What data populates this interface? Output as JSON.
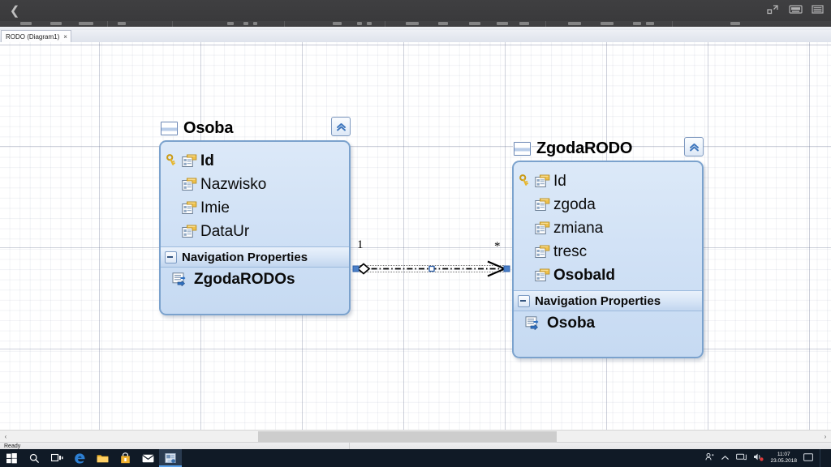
{
  "window": {
    "back_icon": "back-arrow-icon",
    "chrome_buttons": [
      {
        "name": "restore-icon",
        "label": "Restore"
      },
      {
        "name": "keyboard-icon",
        "label": "Touch Keyboard"
      },
      {
        "name": "menu-icon",
        "label": "Menu"
      }
    ]
  },
  "tab": {
    "label": "RODO (Diagram1)",
    "close": "×"
  },
  "diagram": {
    "entities": [
      {
        "name": "Osoba",
        "title": "Osoba",
        "collapse_glyph": "«",
        "properties": [
          {
            "label": "Id",
            "key": true,
            "bold": true
          },
          {
            "label": "Nazwisko",
            "key": false,
            "bold": false
          },
          {
            "label": "Imie",
            "key": false,
            "bold": false
          },
          {
            "label": "DataUr",
            "key": false,
            "bold": false
          }
        ],
        "navigation_header": "Navigation Properties",
        "navigation_properties": [
          {
            "label": "ZgodaRODOs"
          }
        ]
      },
      {
        "name": "ZgodaRODO",
        "title": "ZgodaRODO",
        "collapse_glyph": "«",
        "properties": [
          {
            "label": "Id",
            "key": true,
            "bold": false
          },
          {
            "label": "zgoda",
            "key": false,
            "bold": false
          },
          {
            "label": "zmiana",
            "key": false,
            "bold": false
          },
          {
            "label": "tresc",
            "key": false,
            "bold": false
          },
          {
            "label": "OsobaId",
            "key": false,
            "bold": true
          }
        ],
        "navigation_header": "Navigation Properties",
        "navigation_properties": [
          {
            "label": "Osoba"
          }
        ]
      }
    ],
    "association": {
      "source_multiplicity": "1",
      "target_multiplicity": "*",
      "selected": true
    }
  },
  "status": {
    "text": "Ready"
  },
  "scrollbar": {
    "left_arrow": "‹",
    "right_arrow": "›"
  },
  "taskbar": {
    "items": [
      {
        "name": "start-button",
        "label": "Start"
      },
      {
        "name": "search-icon",
        "label": "Search"
      },
      {
        "name": "task-view-icon",
        "label": "Task View"
      },
      {
        "name": "edge-icon",
        "label": "Microsoft Edge"
      },
      {
        "name": "file-explorer-icon",
        "label": "File Explorer"
      },
      {
        "name": "store-icon",
        "label": "Microsoft Store"
      },
      {
        "name": "mail-icon",
        "label": "Mail"
      },
      {
        "name": "visual-studio-icon",
        "label": "Visual Studio"
      }
    ],
    "tray": [
      {
        "name": "user-account-icon",
        "label": "Account"
      },
      {
        "name": "show-hidden-icons-icon",
        "label": "Show hidden icons"
      },
      {
        "name": "network-icon",
        "label": "Network"
      },
      {
        "name": "volume-icon",
        "label": "Volume"
      }
    ],
    "clock": {
      "time": "11:07",
      "date": "23.05.2018"
    }
  },
  "colors": {
    "entity_border": "#7ba2cd",
    "entity_fill": "#cfe0f5",
    "nav_header": "#c2d6ef",
    "chrome": "#3f3f41",
    "taskbar": "#101a26",
    "key_gold": "#e8b73a"
  }
}
